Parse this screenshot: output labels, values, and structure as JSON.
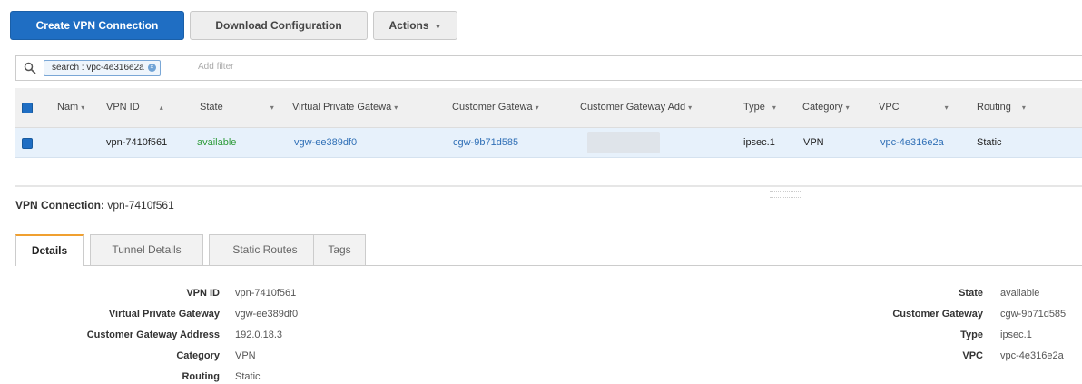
{
  "toolbar": {
    "create_label": "Create VPN Connection",
    "download_label": "Download Configuration",
    "actions_label": "Actions"
  },
  "filter": {
    "token": "search : vpc-4e316e2a",
    "placeholder": "Add filter"
  },
  "table": {
    "columns": [
      "Nam",
      "VPN ID",
      "State",
      "Virtual Private Gatewa",
      "Customer Gatewa",
      "Customer Gateway Add",
      "Type",
      "Category",
      "VPC",
      "Routing"
    ],
    "rows": [
      {
        "name": "",
        "vpn_id": "vpn-7410f561",
        "state": "available",
        "vgw": "vgw-ee389df0",
        "cgw": "cgw-9b71d585",
        "cgw_address": "",
        "type": "ipsec.1",
        "category": "VPN",
        "vpc": "vpc-4e316e2a",
        "routing": "Static"
      }
    ]
  },
  "details": {
    "title_prefix": "VPN Connection:",
    "title_id": "vpn-7410f561",
    "tabs": [
      "Details",
      "Tunnel Details",
      "Static Routes",
      "Tags"
    ],
    "left": [
      {
        "label": "VPN ID",
        "value": "vpn-7410f561"
      },
      {
        "label": "Virtual Private Gateway",
        "value": "vgw-ee389df0"
      },
      {
        "label": "Customer Gateway Address",
        "value": "192.0.18.3"
      },
      {
        "label": "Category",
        "value": "VPN"
      },
      {
        "label": "Routing",
        "value": "Static"
      }
    ],
    "right": [
      {
        "label": "State",
        "value": "available"
      },
      {
        "label": "Customer Gateway",
        "value": "cgw-9b71d585"
      },
      {
        "label": "Type",
        "value": "ipsec.1"
      },
      {
        "label": "VPC",
        "value": "vpc-4e316e2a"
      }
    ]
  },
  "colors": {
    "primary": "#1f6ec3",
    "link": "#2f6fb6",
    "available": "#2e9b3a",
    "tab_accent": "#f0a030"
  }
}
